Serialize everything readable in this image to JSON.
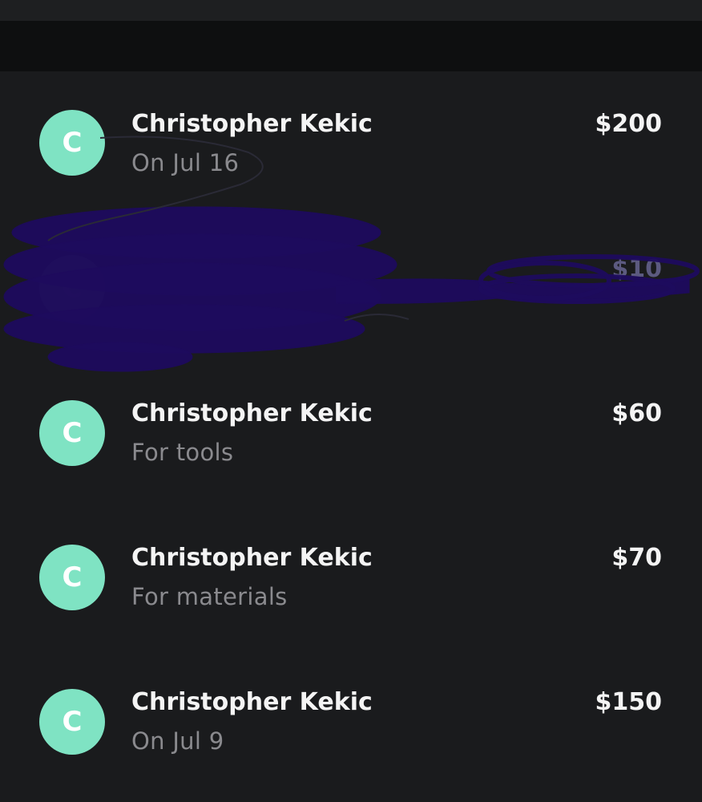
{
  "transactions": [
    {
      "avatar_letter": "C",
      "name": "Christopher Kekic",
      "note": "On Jul 16",
      "amount": "$200"
    },
    {
      "avatar_letter": "C",
      "name": "",
      "note": "",
      "amount": "$10",
      "redacted": true
    },
    {
      "avatar_letter": "C",
      "name": "Christopher Kekic",
      "note": "For tools",
      "amount": "$60"
    },
    {
      "avatar_letter": "C",
      "name": "Christopher Kekic",
      "note": "For materials",
      "amount": "$70"
    },
    {
      "avatar_letter": "C",
      "name": "Christopher Kekic",
      "note": "On Jul 9",
      "amount": "$150"
    }
  ],
  "colors": {
    "background": "#1a1b1d",
    "header": "#0e0f10",
    "avatar": "#7fe3c3",
    "primary_text": "#f4f4f4",
    "secondary_text": "#8a8a8e",
    "redaction_ink": "#1e0b5e"
  }
}
